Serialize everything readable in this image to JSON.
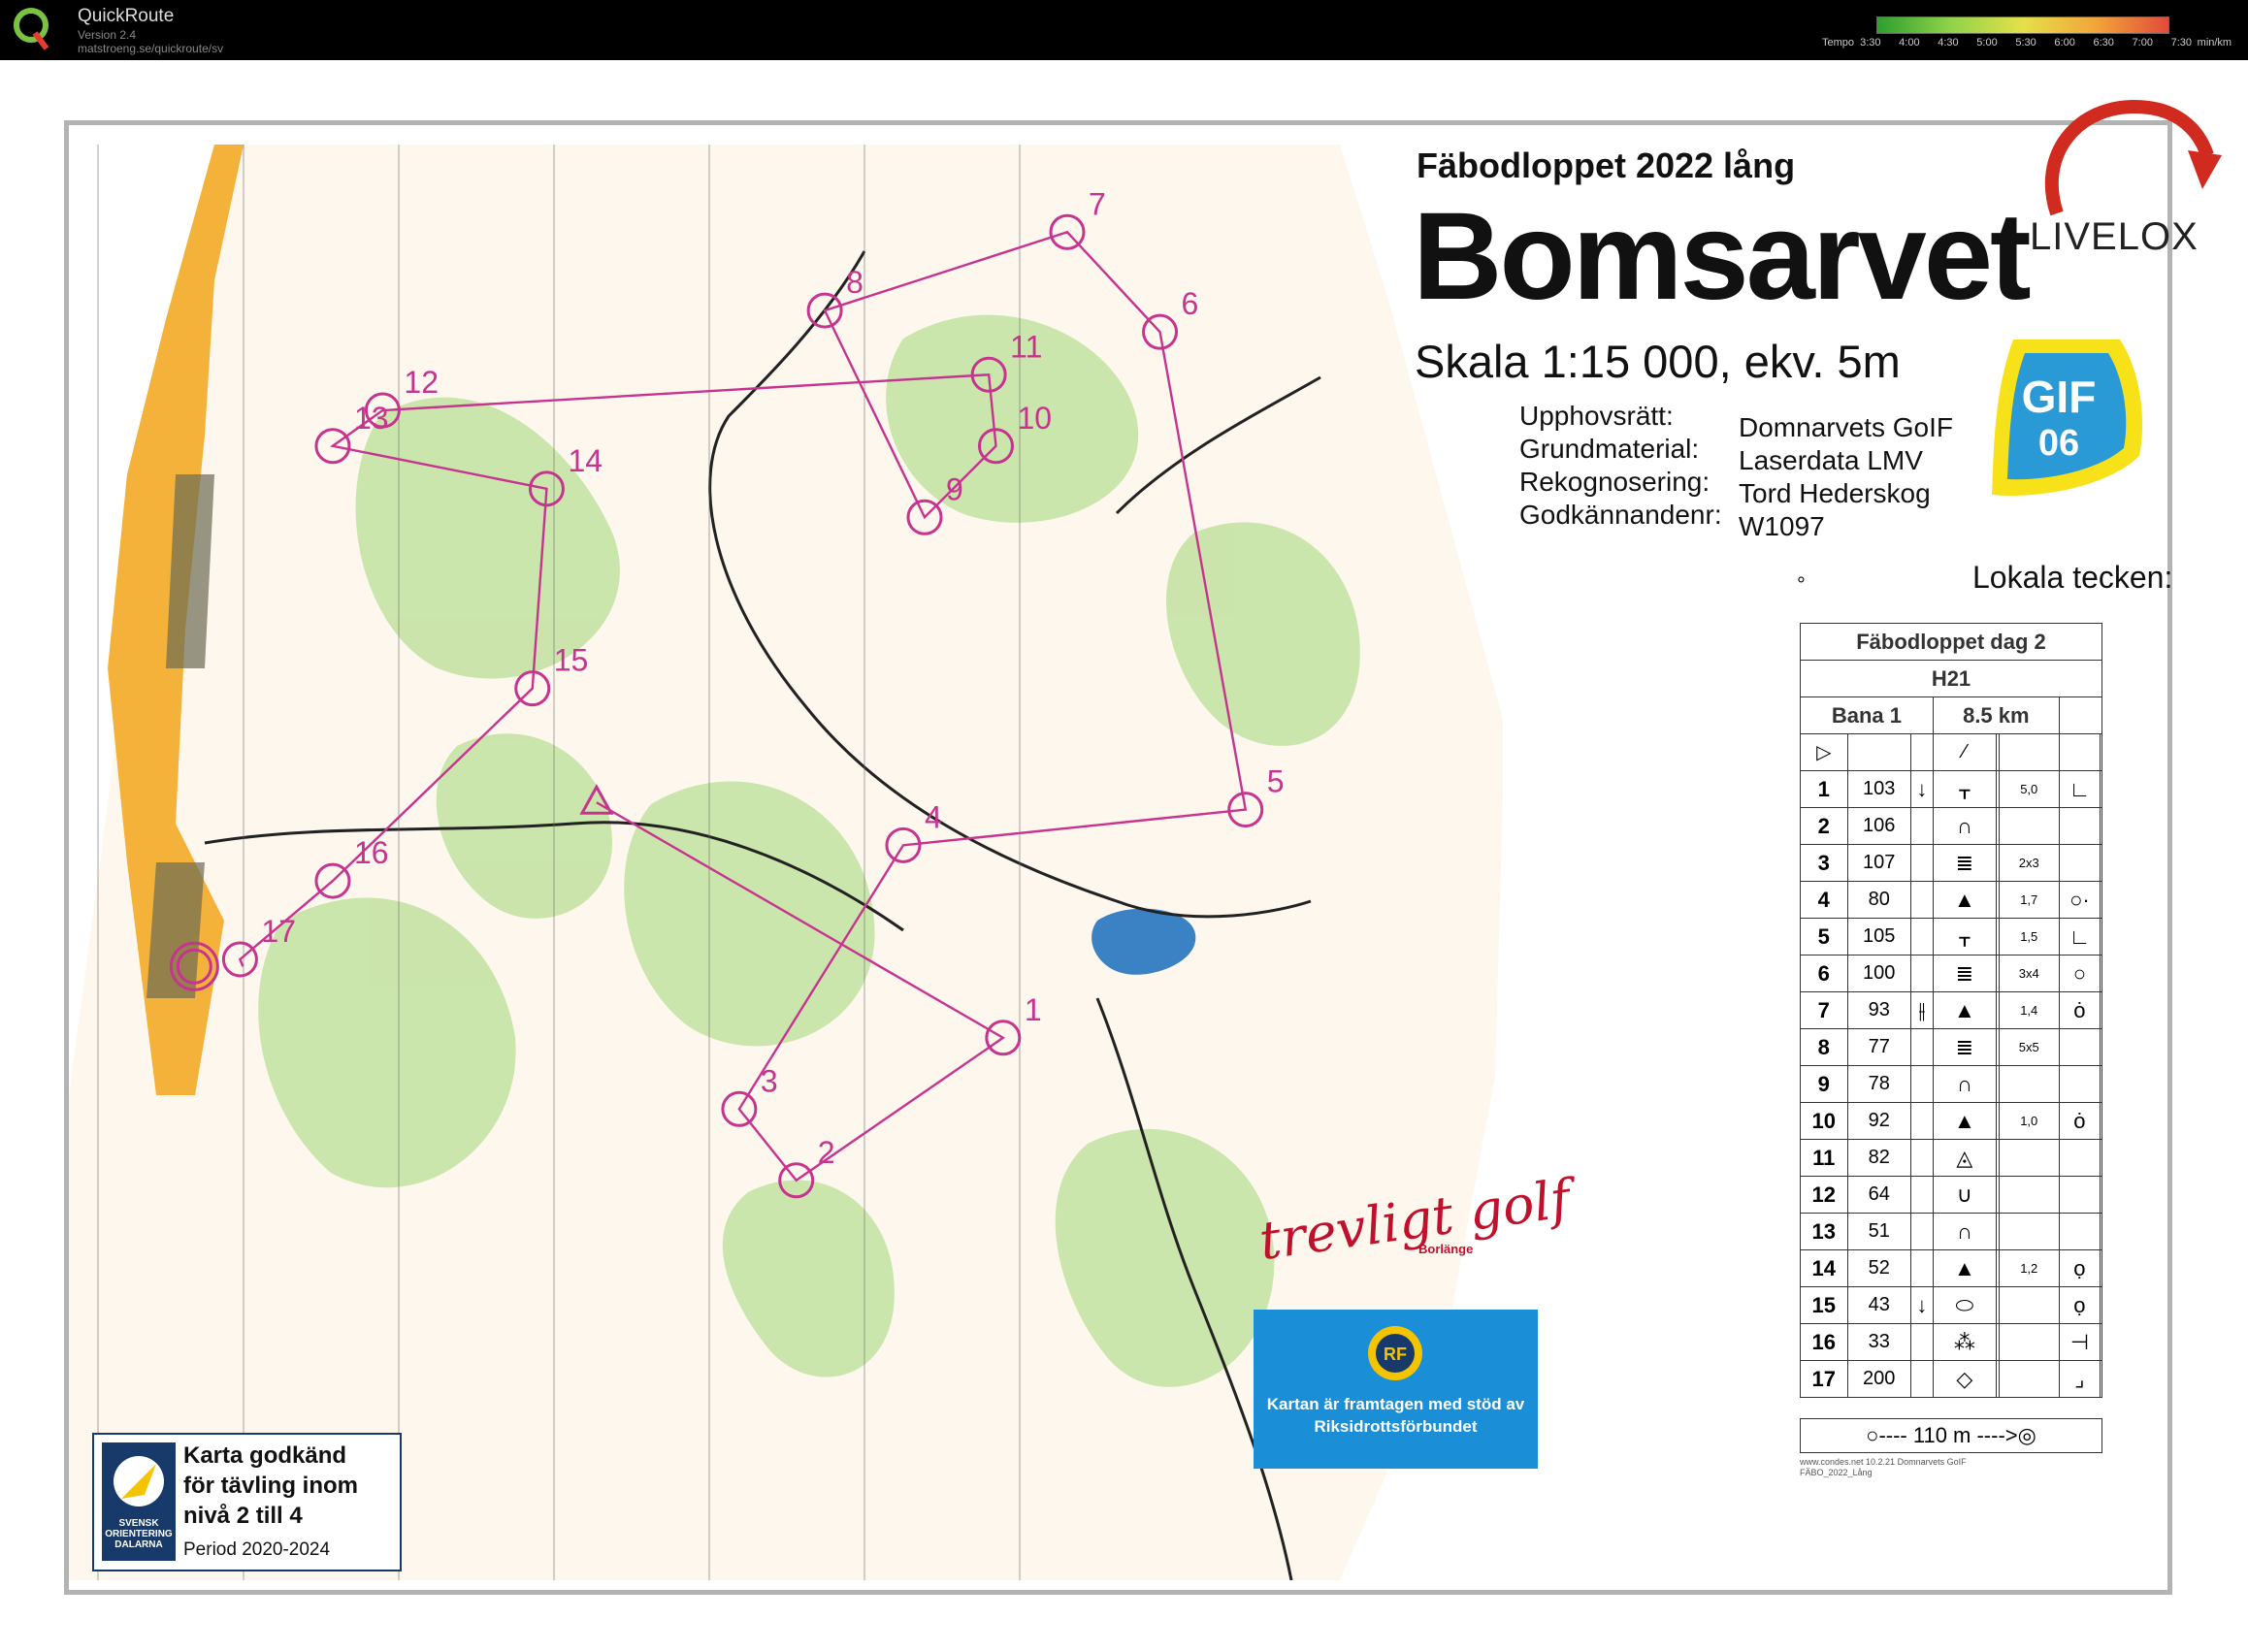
{
  "app": {
    "name": "QuickRoute",
    "version": "Version 2.4",
    "url": "matstroeng.se/quickroute/sv",
    "pace_legend": {
      "label": "Tempo",
      "ticks": [
        "3:30",
        "4:00",
        "4:30",
        "5:00",
        "5:30",
        "6:00",
        "6:30",
        "7:00",
        "7:30"
      ],
      "unit": "min/km",
      "colors": [
        "#2e9e2e",
        "#8fd24a",
        "#e5e04a",
        "#f2a53a",
        "#e14b3b"
      ]
    }
  },
  "map": {
    "event_title": "Fäbodloppet 2022 lång",
    "map_name": "Bomsarvet",
    "scale": "Skala 1:15 000, ekv. 5m",
    "credits": [
      {
        "label": "Upphovsrätt:",
        "value": "Domnarvets GoIF"
      },
      {
        "label": "Grundmaterial:",
        "value": "Laserdata LMV"
      },
      {
        "label": "Rekognosering:",
        "value": "Tord Hederskog"
      },
      {
        "label": "Godkännandenr:",
        "value": "W1097"
      }
    ],
    "local_symbols": "Lokala tecken:",
    "local_symbol_mark": "°",
    "livelox": "LIVELOX",
    "club_badge": {
      "line1": "GIF",
      "line2": "06"
    },
    "course_control_numbers": [
      "1",
      "2",
      "3",
      "4",
      "5",
      "6",
      "7",
      "8",
      "9",
      "10",
      "11",
      "12",
      "13",
      "14",
      "15",
      "16",
      "17"
    ],
    "sponsor_text": "trevligt golf",
    "sponsor_sub": "Borlänge",
    "rf_text": "Kartan är framtagen med stöd av Riksidrottsförbundet",
    "rf_logo": "RF",
    "approval": {
      "lines": [
        "Karta godkänd",
        "för tävling inom",
        "nivå 2 till 4"
      ],
      "period": "Period 2020-2024",
      "logo_text": "SVENSK ORIENTERING DALARNA"
    }
  },
  "control_card": {
    "title": "Fäbodloppet dag 2",
    "class": "H21",
    "course": "Bana 1",
    "length": "8.5 km",
    "rows": [
      {
        "n": "1",
        "code": "103",
        "c": "↓",
        "d": "ᚁ",
        "e": "5,0",
        "f": "∟"
      },
      {
        "n": "2",
        "code": "106",
        "c": "",
        "d": "∩",
        "e": "",
        "f": ""
      },
      {
        "n": "3",
        "code": "107",
        "c": "",
        "d": "≣",
        "e": "2x3",
        "f": ""
      },
      {
        "n": "4",
        "code": "80",
        "c": "",
        "d": "▲",
        "e": "1,7",
        "f": "○·"
      },
      {
        "n": "5",
        "code": "105",
        "c": "",
        "d": "ᚁ",
        "e": "1,5",
        "f": "∟"
      },
      {
        "n": "6",
        "code": "100",
        "c": "",
        "d": "≣",
        "e": "3x4",
        "f": "○"
      },
      {
        "n": "7",
        "code": "93",
        "c": "⫲",
        "d": "▲",
        "e": "1,4",
        "f": "ȯ"
      },
      {
        "n": "8",
        "code": "77",
        "c": "",
        "d": "≣",
        "e": "5x5",
        "f": ""
      },
      {
        "n": "9",
        "code": "78",
        "c": "",
        "d": "∩",
        "e": "",
        "f": ""
      },
      {
        "n": "10",
        "code": "92",
        "c": "",
        "d": "▲",
        "e": "1,0",
        "f": "ȯ"
      },
      {
        "n": "11",
        "code": "82",
        "c": "",
        "d": "◬",
        "e": "",
        "f": ""
      },
      {
        "n": "12",
        "code": "64",
        "c": "",
        "d": "∪",
        "e": "",
        "f": ""
      },
      {
        "n": "13",
        "code": "51",
        "c": "",
        "d": "∩",
        "e": "",
        "f": ""
      },
      {
        "n": "14",
        "code": "52",
        "c": "",
        "d": "▲",
        "e": "1,2",
        "f": "ọ"
      },
      {
        "n": "15",
        "code": "43",
        "c": "↓",
        "d": "⬭",
        "e": "",
        "f": "ọ"
      },
      {
        "n": "16",
        "code": "33",
        "c": "",
        "d": "⁂",
        "e": "",
        "f": "⊣"
      },
      {
        "n": "17",
        "code": "200",
        "c": "",
        "d": "◇",
        "e": "",
        "f": "⌟"
      }
    ],
    "finish": "○---- 110 m ---->◎",
    "footer1": "www.condes.net 10.2.21 Domnarvets GoIF",
    "footer2": "FÄBO_2022_Lång"
  }
}
